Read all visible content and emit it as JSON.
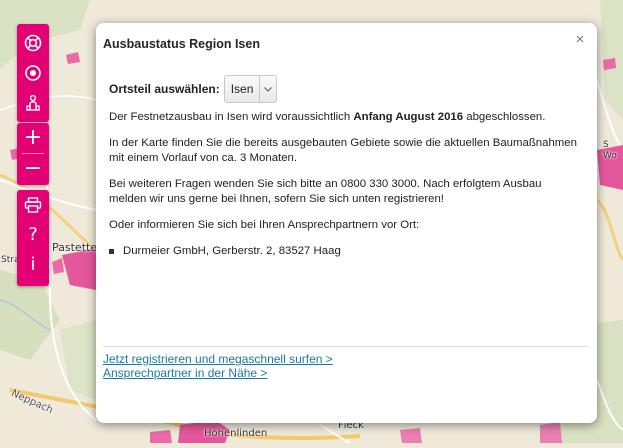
{
  "map": {
    "labels": {
      "pastetten": "Pastetten",
      "str": "Stra",
      "hohenlinden": "Hohenlinden",
      "fleck": "Fleck",
      "so": "S Wo",
      "nepp": "Neppach"
    }
  },
  "toolbar": {
    "items": [
      {
        "icon": "lifebuoy-icon"
      },
      {
        "icon": "locate-icon"
      },
      {
        "icon": "person-info-icon"
      },
      {
        "icon": "zoom-in-icon",
        "glyph": "+"
      },
      {
        "icon": "zoom-out-icon",
        "glyph": "−"
      },
      {
        "icon": "print-icon"
      },
      {
        "icon": "help-icon",
        "glyph": "?"
      },
      {
        "icon": "info-icon",
        "glyph": "i"
      }
    ],
    "color": "#e20074"
  },
  "dialog": {
    "title": "Ausbaustatus Region Isen",
    "close_glyph": "×",
    "ortsteil_label": "Ortsteil auswählen:",
    "ortsteil_value": "Isen",
    "para1_prefix": "Der Festnetzausbau in Isen wird voraussichtlich ",
    "para1_bold": "Anfang August 2016",
    "para1_suffix": " abgeschlossen.",
    "para2": "In der Karte finden Sie die bereits ausgebauten Gebiete sowie die aktuellen Baumaßnahmen mit einem Vorlauf von ca. 3 Monaten.",
    "para3": "Bei weiteren Fragen wenden Sie sich bitte an 0800 330 3000. Nach erfolgtem Ausbau melden wir uns gerne bei Ihnen, sofern Sie sich unten registrieren!",
    "para4": "Oder informieren Sie sich bei Ihren Ansprechpartnern vor Ort:",
    "contact": "Durmeier GmbH, Gerberstr. 2, 83527 Haag",
    "link1": "Jetzt registrieren und megaschnell surfen >",
    "link2": "Ansprechpartner in der Nähe >",
    "link_color": "#1a7aa5"
  }
}
